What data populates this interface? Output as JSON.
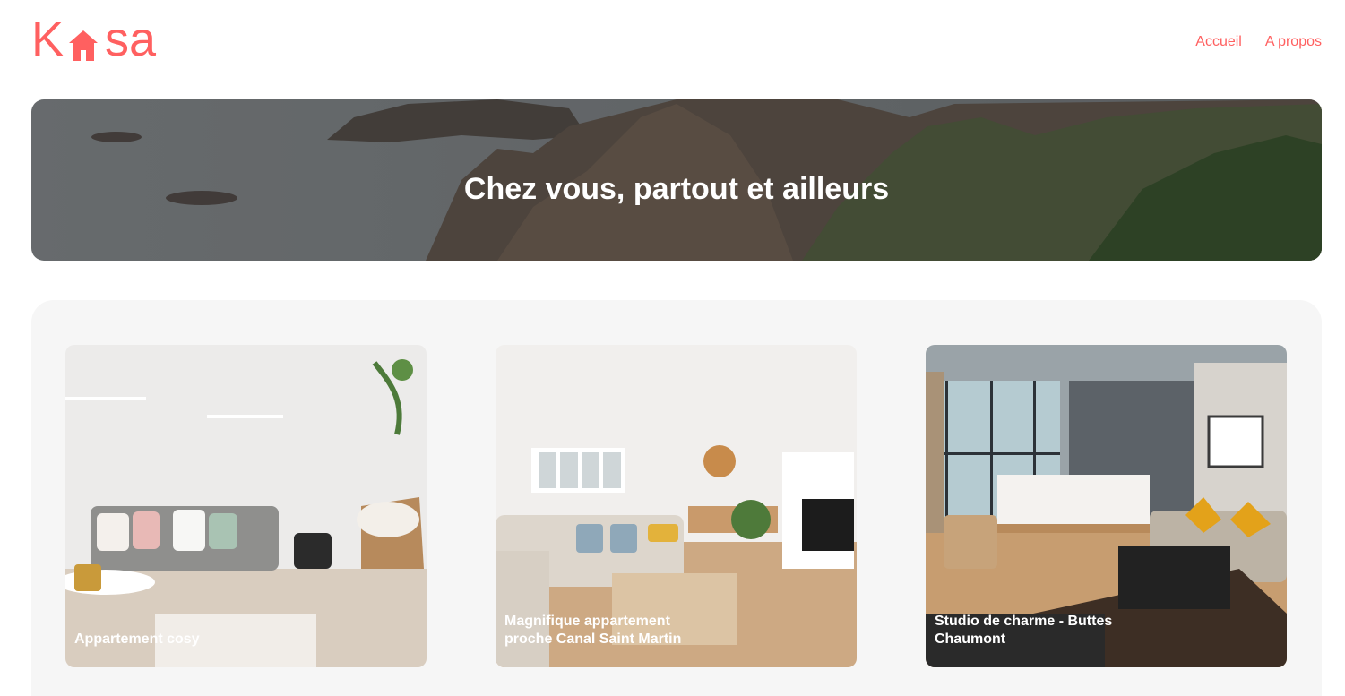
{
  "brand": {
    "logo_text": "Kasa",
    "color": "#FF6060"
  },
  "nav": {
    "items": [
      {
        "label": "Accueil",
        "active": true
      },
      {
        "label": "A propos",
        "active": false
      }
    ]
  },
  "banner": {
    "title": "Chez vous, partout et ailleurs"
  },
  "gallery": {
    "cards": [
      {
        "title": "Appartement cosy"
      },
      {
        "title": "Magnifique appartement proche Canal Saint Martin"
      },
      {
        "title": "Studio de charme - Buttes Chaumont"
      }
    ]
  }
}
